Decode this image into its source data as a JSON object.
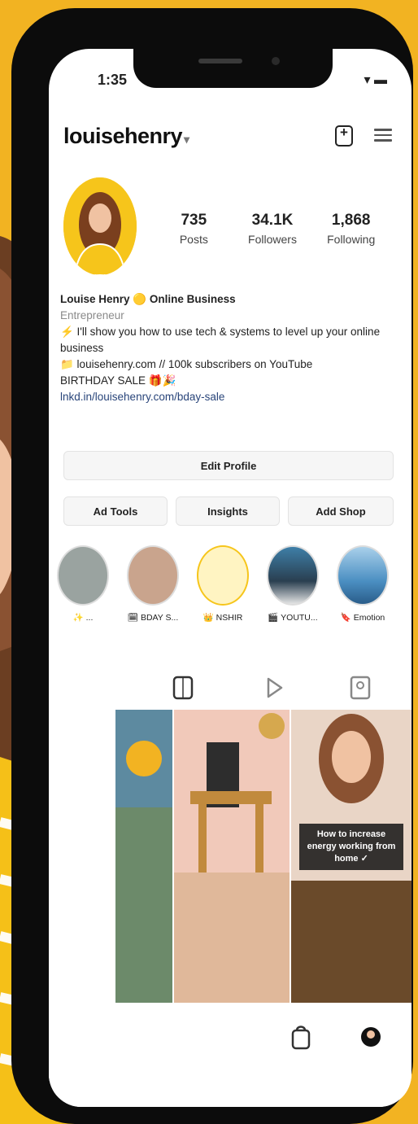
{
  "status_bar": {
    "time": "1:35",
    "icons": "▾ ▬"
  },
  "header": {
    "username": "louisehenry",
    "chevron": "▾"
  },
  "icons": {
    "add": "add-post-icon",
    "menu": "hamburger-menu-icon"
  },
  "profile": {
    "stats": [
      {
        "value": "735",
        "label": "Posts"
      },
      {
        "value": "34.1K",
        "label": "Followers"
      },
      {
        "value": "1,868",
        "label": "Following"
      }
    ],
    "bio": {
      "name": "Louise Henry 🟡 Online Business",
      "category": "Entrepreneur",
      "line1": "⚡ I'll show you how to use tech & systems to level up your online business",
      "line2": "📁 louisehenry.com // 100k subscribers on YouTube",
      "line3": "BIRTHDAY SALE 🎁🎉",
      "link": "lnkd.in/louisehenry.com/bday-sale"
    }
  },
  "buttons": {
    "edit_profile": "Edit Profile",
    "ad_tools": "Ad Tools",
    "insights": "Insights",
    "add_shop": "Add Shop"
  },
  "highlights": [
    {
      "label": "✨ ..."
    },
    {
      "label": "🗓 BDAY S..."
    },
    {
      "label": "👑 NSHIR"
    },
    {
      "label": "🎬 YOUTU..."
    },
    {
      "label": "🔖 Emotion"
    }
  ],
  "post_overlay": "How to increase energy working from home ✓",
  "colors": {
    "background": "#F2B322",
    "accent_yellow": "#F6C51B",
    "link": "#29457a"
  }
}
